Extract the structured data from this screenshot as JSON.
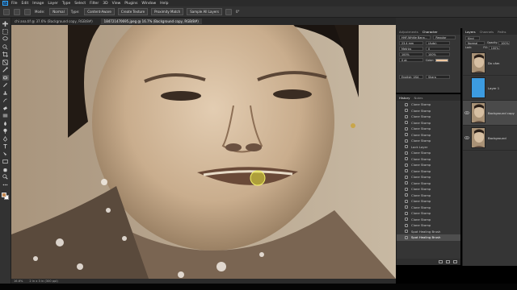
{
  "app": {
    "logo": "Ps"
  },
  "menu": [
    "File",
    "Edit",
    "Image",
    "Layer",
    "Type",
    "Select",
    "Filter",
    "3D",
    "View",
    "Plugins",
    "Window",
    "Help"
  ],
  "options_bar": {
    "mode_label": "Mode:",
    "mode_value": "Normal",
    "type_label": "Type:",
    "content_aware": "Content-Aware",
    "create_texture": "Create Texture",
    "proximity_match": "Proximity Match",
    "sample_all_layers": "Sample All Layers",
    "angle_value": "0°"
  },
  "tabs": [
    "chi ana.tif @ 37.6% (Background copy, RGB/8#)",
    "184721470695.jpeg @ 16.7% (Background copy, RGB/8#)"
  ],
  "status": {
    "zoom": "16.6%",
    "doc": "2 in x 3 in (300 ppi)"
  },
  "character_panel": {
    "tabs": [
      "Adjustments",
      "Character"
    ],
    "font_family": "HHF-Whitle Bana...",
    "font_style": "Regular",
    "size": "23.4 mm",
    "leading": "(Auto)",
    "tracking": "0",
    "kerning": "Metrics",
    "vscale": "100%",
    "hscale": "100%",
    "baseline": "0 pt",
    "color_label": "Color:",
    "language": "English: USA",
    "aa": "Sharp",
    "text_color": "#f0c8a0"
  },
  "history_panel": {
    "tabs": [
      "History",
      "Notes"
    ],
    "items": [
      "Clone Stamp",
      "Clone Stamp",
      "Clone Stamp",
      "Clone Stamp",
      "Clone Stamp",
      "Clone Stamp",
      "Clone Stamp",
      "Lock Layer",
      "Clone Stamp",
      "Clone Stamp",
      "Clone Stamp",
      "Clone Stamp",
      "Clone Stamp",
      "Clone Stamp",
      "Clone Stamp",
      "Clone Stamp",
      "Clone Stamp",
      "Clone Stamp",
      "Clone Stamp",
      "Clone Stamp",
      "Clone Stamp",
      "Spot Healing Brush",
      "Spot Healing Brush"
    ],
    "selected_index": 22
  },
  "layers_panel": {
    "tabs": [
      "Layers",
      "Channels",
      "Paths"
    ],
    "kind_label": "Kind",
    "blend_mode": "Normal",
    "opacity_label": "Opacity:",
    "opacity_value": "100%",
    "lock_label": "Lock:",
    "fill_label": "Fill:",
    "fill_value": "100%",
    "layers": [
      {
        "name": "Dx câm",
        "visible": false,
        "thumb": "face"
      },
      {
        "name": "Layer 1",
        "visible": false,
        "thumb": "blue"
      },
      {
        "name": "Background copy",
        "visible": true,
        "thumb": "face",
        "selected": true
      },
      {
        "name": "Background",
        "visible": true,
        "thumb": "face"
      }
    ]
  },
  "colors": {
    "ui_dark": "#323232",
    "panel": "#353535",
    "accent": "#31a8ff",
    "foreground_swatch": "#c48a52"
  }
}
